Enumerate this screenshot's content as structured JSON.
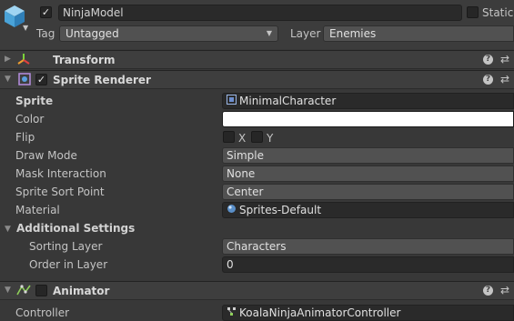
{
  "header": {
    "active_checked": true,
    "object_name": "NinjaModel",
    "static_label": "Static",
    "tag_label": "Tag",
    "tag_value": "Untagged",
    "layer_label": "Layer",
    "layer_value": "Enemies"
  },
  "components": {
    "transform": {
      "title": "Transform"
    },
    "sprite_renderer": {
      "title": "Sprite Renderer",
      "enabled": true,
      "properties": {
        "sprite": {
          "label": "Sprite",
          "value": "MinimalCharacter"
        },
        "color": {
          "label": "Color",
          "value": "#ffffff"
        },
        "flip": {
          "label": "Flip",
          "x_label": "X",
          "y_label": "Y",
          "x_checked": false,
          "y_checked": false
        },
        "draw_mode": {
          "label": "Draw Mode",
          "value": "Simple"
        },
        "mask_interaction": {
          "label": "Mask Interaction",
          "value": "None"
        },
        "sprite_sort_point": {
          "label": "Sprite Sort Point",
          "value": "Center"
        },
        "material": {
          "label": "Material",
          "value": "Sprites-Default"
        }
      },
      "additional_settings": {
        "label": "Additional Settings",
        "sorting_layer": {
          "label": "Sorting Layer",
          "value": "Characters"
        },
        "order_in_layer": {
          "label": "Order in Layer",
          "value": "0"
        }
      }
    },
    "animator": {
      "title": "Animator",
      "enabled": false,
      "controller": {
        "label": "Controller",
        "value": "KoalaNinjaAnimatorController"
      }
    }
  },
  "colors": {
    "background": "#383838",
    "header_background": "#3e3e3e",
    "field_dark": "#2a2a2a",
    "dropdown": "#515151",
    "text": "#c4c4c4",
    "color_swatch": "#ffffff"
  },
  "icons": {
    "gameobject": "cube-icon",
    "transform": "transform-axes-icon",
    "sprite_renderer": "sprite-renderer-icon",
    "animator": "animator-icon",
    "help": "help-icon",
    "settings": "settings-sliders-icon"
  }
}
